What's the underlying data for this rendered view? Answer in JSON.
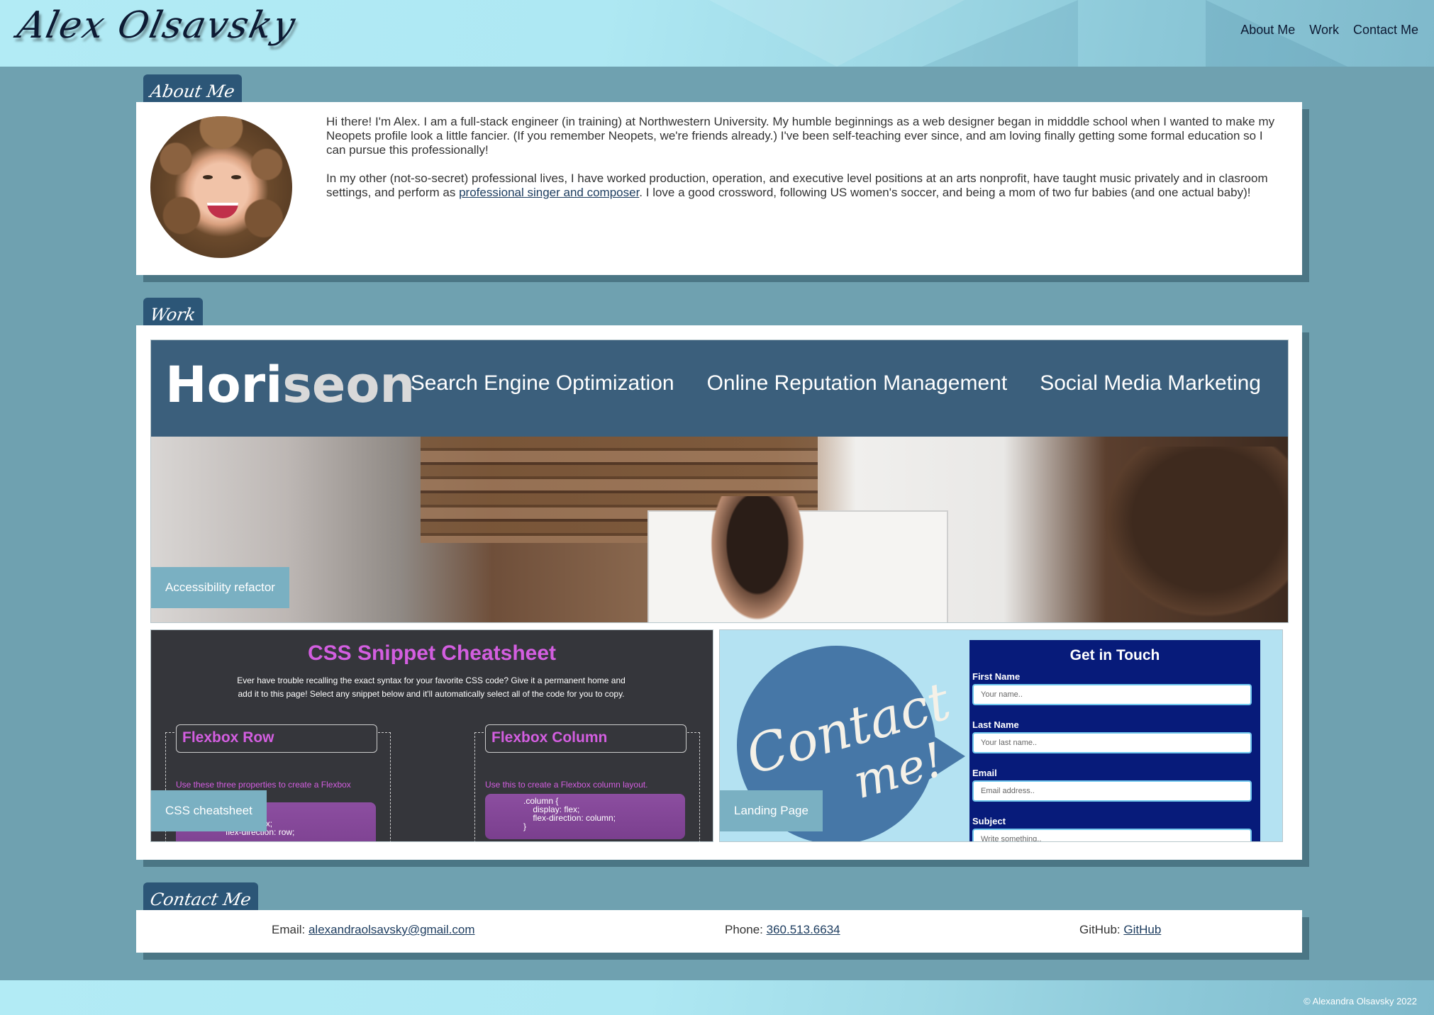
{
  "header": {
    "logo": "Alex Olsavsky",
    "nav": [
      "About Me",
      "Work",
      "Contact Me"
    ]
  },
  "about": {
    "heading": "About Me",
    "para1": "Hi there! I'm Alex. I am a full-stack engineer (in training) at Northwestern University. My humble beginnings as a web designer began in midddle school when I wanted to make my Neopets profile look a little fancier. (If you remember Neopets, we're friends already.) I've been self-teaching ever since, and am loving finally getting some formal education so I can pursue this professionally!",
    "para2_before": "In my other (not-so-secret) professional lives, I have worked production, operation, and executive level positions at an arts nonprofit, have taught music privately and in clasroom settings, and perform as ",
    "para2_link": "professional singer and composer",
    "para2_after": ". I love a good crossword, following US women's soccer, and being a mom of two fur babies (and one actual baby)!"
  },
  "work": {
    "heading": "Work",
    "projects": [
      {
        "label": "Accessibility refactor",
        "preview": {
          "logo_a": "Hori",
          "logo_b": "seon",
          "links": [
            "Search Engine Optimization",
            "Online Reputation Management",
            "Social Media Marketing"
          ]
        }
      },
      {
        "label": "CSS cheatsheet",
        "preview": {
          "title": "CSS Snippet Cheatsheet",
          "desc": "Ever have trouble recalling the exact syntax for your favorite CSS code? Give it a permanent home and add it to this page! Select any snippet below and it'll automatically select all of the code for you to copy.",
          "col1_title": "Flexbox Row",
          "col1_sub": "Use these three properties to create a Flexbox",
          "col1_code": "display: flex;\nflex-direction: row;",
          "col2_title": "Flexbox Column",
          "col2_sub": "Use this to create a Flexbox column layout.",
          "col2_code": ".column {\n    display: flex;\n    flex-direction: column;\n}"
        }
      },
      {
        "label": "Landing Page",
        "preview": {
          "bubble_line1": "Contact",
          "bubble_line2": "me!",
          "form_title": "Get in Touch",
          "fields": [
            {
              "label": "First Name",
              "placeholder": "Your name.."
            },
            {
              "label": "Last Name",
              "placeholder": "Your last name.."
            },
            {
              "label": "Email",
              "placeholder": "Email address.."
            },
            {
              "label": "Subject",
              "placeholder": "Write something.."
            }
          ]
        }
      }
    ]
  },
  "contact": {
    "heading": "Contact Me",
    "email_label": "Email:",
    "email": "alexandraolsavsky@gmail.com",
    "phone_label": "Phone:",
    "phone": "360.513.6634",
    "github_label": "GitHub:",
    "github": "GitHub"
  },
  "footer": {
    "copyright": "© Alexandra Olsavsky 2022"
  },
  "colors": {
    "page_bg": "#6fa1b0",
    "header_bg": "#b2ebf5",
    "tab_bg": "#2c5677",
    "label_bg": "#7ab0c2",
    "link": "#1b3b5e"
  }
}
